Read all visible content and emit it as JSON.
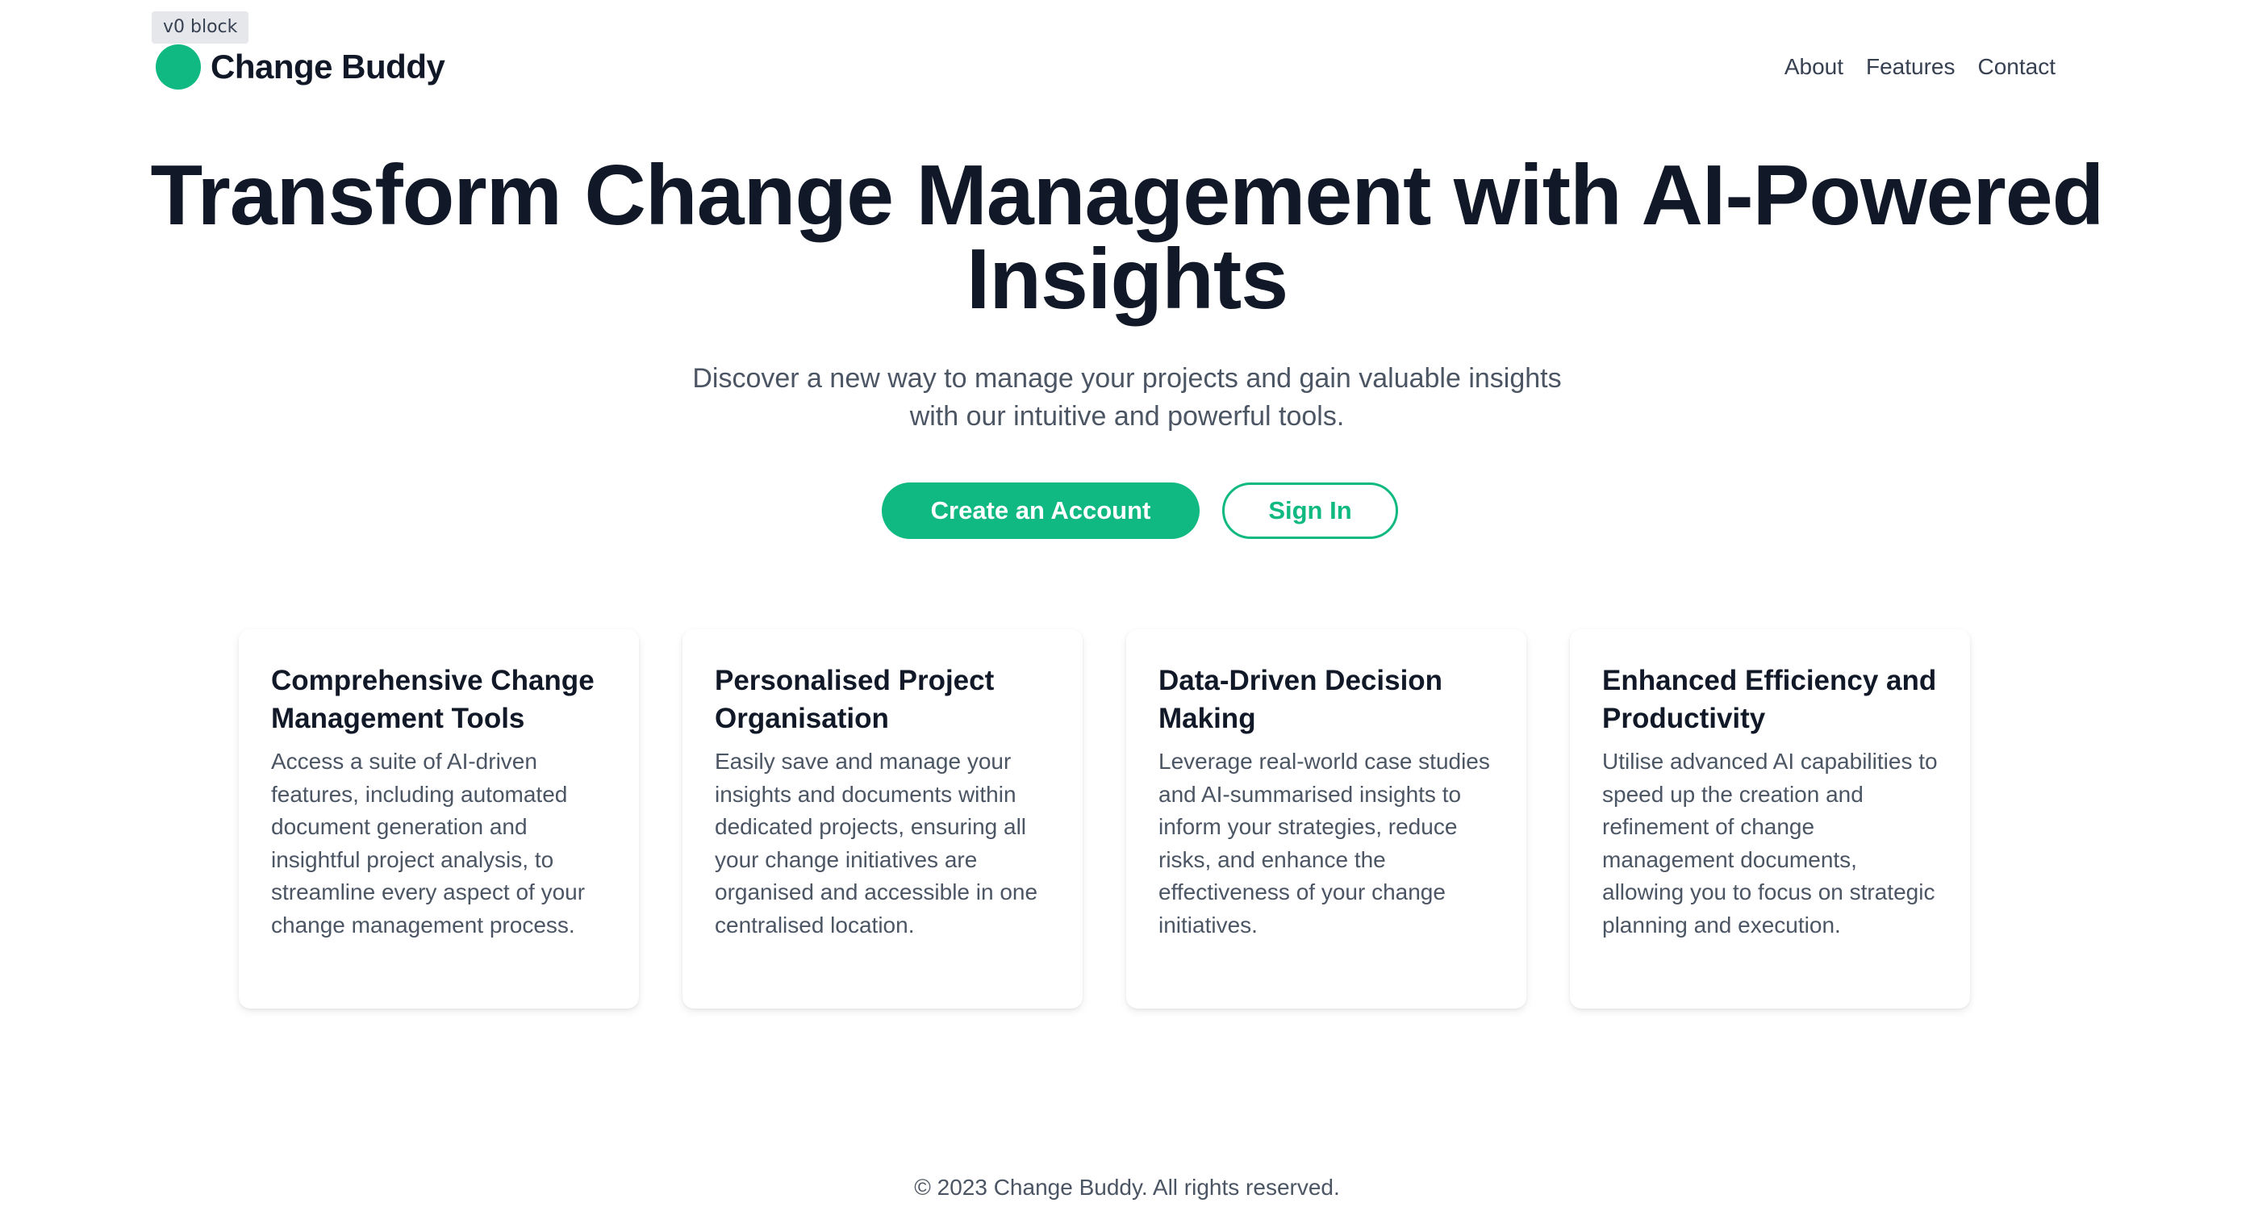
{
  "badge": {
    "label": "v0 block"
  },
  "header": {
    "brand_name": "Change Buddy",
    "brand_icon": "green-circle-logo",
    "nav": [
      {
        "label": "About"
      },
      {
        "label": "Features"
      },
      {
        "label": "Contact"
      }
    ]
  },
  "hero": {
    "title_line1": "Transform Change Management with AI-Powered",
    "title_line2": "Insights",
    "subtitle_line1": "Discover a new way to manage your projects and gain valuable insights",
    "subtitle_line2": "with our intuitive and powerful tools.",
    "primary_button": "Create an Account",
    "secondary_button": "Sign In"
  },
  "features": [
    {
      "title": "Comprehensive Change Management Tools",
      "text": "Access a suite of AI-driven features, including automated document generation and insightful project analysis, to streamline every aspect of your change management process."
    },
    {
      "title": "Personalised Project Organisation",
      "text": "Easily save and manage your insights and documents within dedicated projects, ensuring all your change initiatives are organised and accessible in one centralised location."
    },
    {
      "title": "Data-Driven Decision Making",
      "text": "Leverage real-world case studies and AI-summarised insights to inform your strategies, reduce risks, and enhance the effectiveness of your change initiatives."
    },
    {
      "title": "Enhanced Efficiency and Productivity",
      "text": "Utilise advanced AI capabilities to speed up the creation and refinement of change management documents, allowing you to focus on strategic planning and execution."
    }
  ],
  "footer": {
    "copyright": "© 2023 Change Buddy. All rights reserved."
  },
  "colors": {
    "accent": "#10b981",
    "heading": "#111827",
    "body_text": "#4b5563"
  }
}
